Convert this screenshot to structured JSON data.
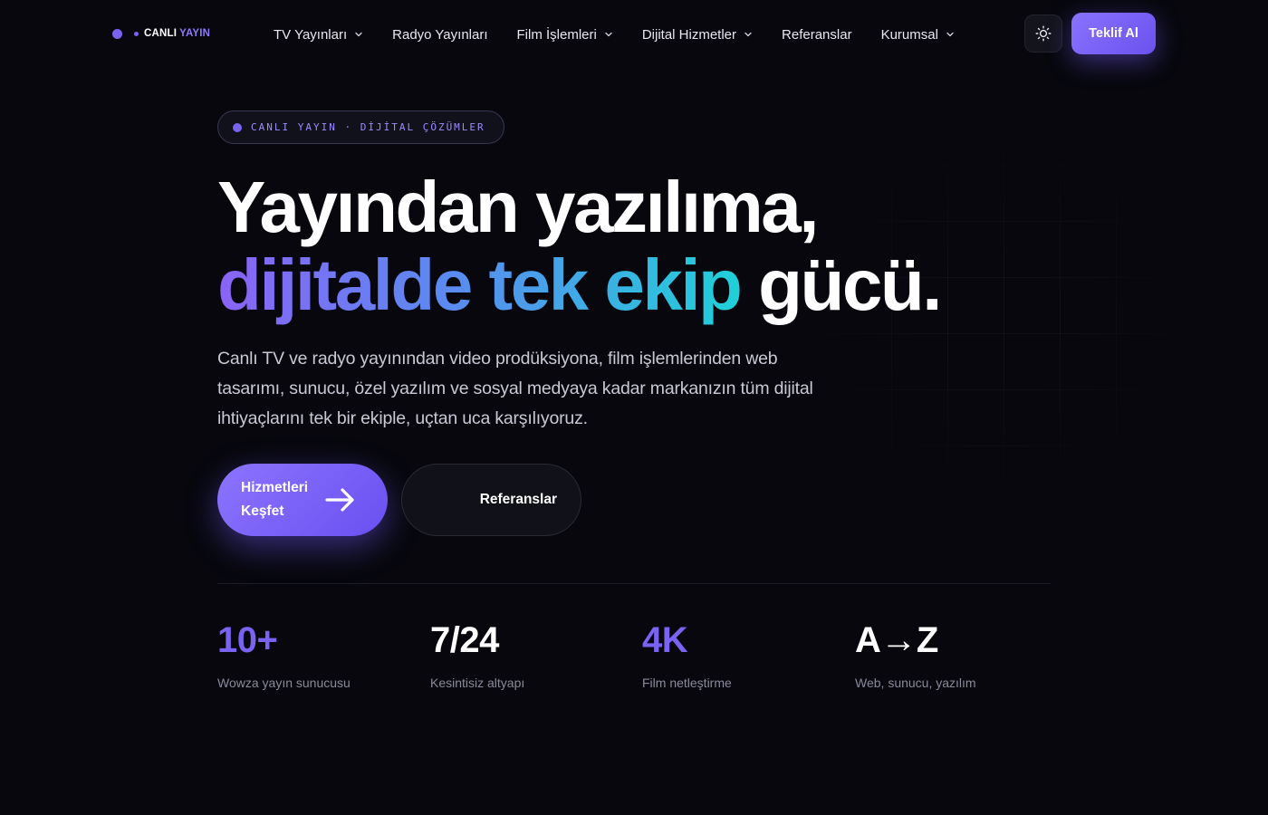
{
  "brand": {
    "name_part1": "CANLI",
    "name_part2": "YAYIN",
    "accent": "#7b63f2"
  },
  "nav": {
    "items": [
      {
        "label": "TV Yayınları",
        "has_dropdown": true
      },
      {
        "label": "Radyo Yayınları",
        "has_dropdown": false
      },
      {
        "label": "Film İşlemleri",
        "has_dropdown": true
      },
      {
        "label": "Dijital Hizmetler",
        "has_dropdown": true
      },
      {
        "label": "Referanslar",
        "has_dropdown": false
      },
      {
        "label": "Kurumsal",
        "has_dropdown": true
      }
    ],
    "theme_toggle_icon": "sun-icon",
    "cta_label": "Teklif Al"
  },
  "hero": {
    "badge": "CANLI YAYIN · DİJİTAL ÇÖZÜMLER",
    "title_line1": "Yayından yazılıma,",
    "title_line2_gradient": "dijitalde tek ekip",
    "title_line2_plain": "gücü.",
    "lead": "Canlı TV ve radyo yayınından video prodüksiyona, film işlemlerinden web tasarımı, sunucu, özel yazılım ve sosyal medyaya kadar markanızın tüm dijital ihtiyaçlarını tek bir ekiple, uçtan uca karşılıyoruz.",
    "primary_button_line1": "Hizmetleri",
    "primary_button_line2": "Keşfet",
    "primary_button_icon": "arrow-right-icon",
    "secondary_button": "Referanslar"
  },
  "stats": [
    {
      "value": "10+",
      "label": "Wowza yayın sunucusu",
      "color": "#7b63f2"
    },
    {
      "value": "7/24",
      "label": "Kesintisiz altyapı",
      "color": "#ffffff"
    },
    {
      "value": "4K",
      "label": "Film netleştirme",
      "color": "#7b63f2"
    },
    {
      "value": "A→Z",
      "label": "Web, sunucu, yazılım",
      "color": "#ffffff"
    }
  ]
}
